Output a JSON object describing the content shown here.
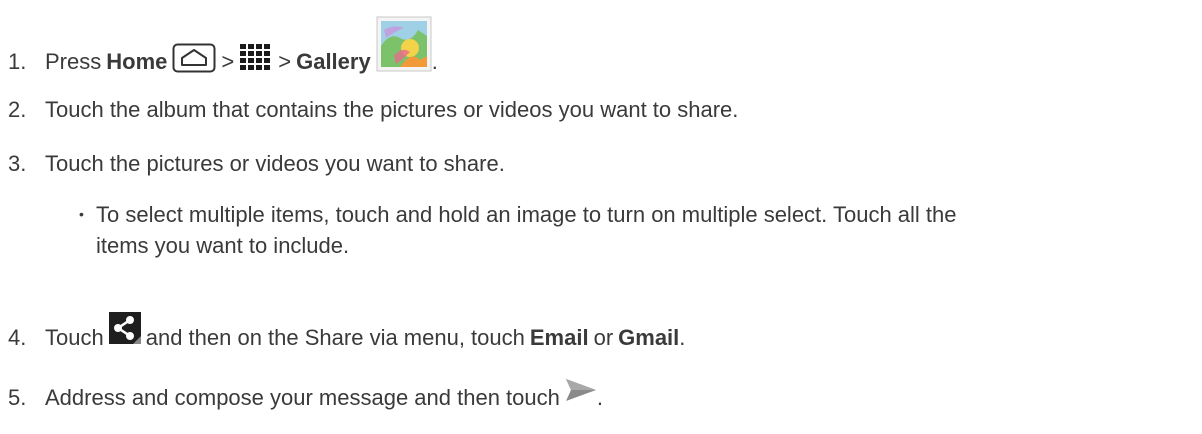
{
  "steps": [
    {
      "number": "1.",
      "press": "Press",
      "home": "Home",
      "sep1": ">",
      "sep2": ">",
      "gallery": "Gallery",
      "end": ".",
      "icons": [
        "home-key-icon",
        "apps-grid-icon",
        "gallery-app-icon"
      ]
    },
    {
      "number": "2.",
      "text": "Touch the album that contains the pictures or videos you want to share."
    },
    {
      "number": "3.",
      "text": "Touch the pictures or videos you want to share."
    },
    {
      "number": "4.",
      "touch": "Touch",
      "middle": "and then on the Share via menu, touch",
      "email": "Email",
      "or": "or",
      "gmail": "Gmail",
      "end": ".",
      "icons": [
        "share-icon"
      ]
    },
    {
      "number": "5.",
      "text": "Address and compose your message and then touch",
      "end": ".",
      "icons": [
        "send-icon"
      ]
    }
  ],
  "bullet": {
    "marker": "•",
    "line1": "To select multiple items, touch and hold an image to turn on multiple select. Touch all the",
    "line2": "items you want to include."
  }
}
